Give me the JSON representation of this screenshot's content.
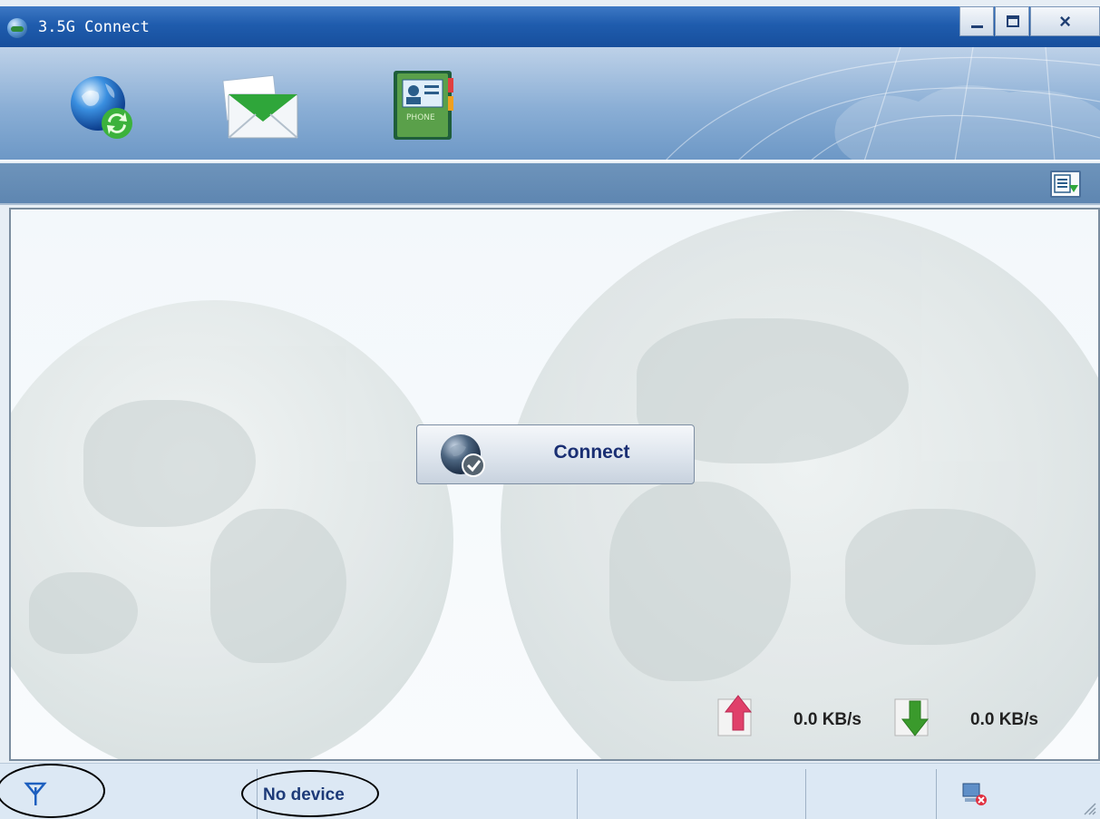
{
  "window": {
    "title": "3.5G Connect",
    "controls": {
      "minimize": "minimize",
      "maximize": "maximize",
      "close": "×"
    }
  },
  "toolbar": {
    "buttons": [
      {
        "id": "internet",
        "icon": "globe-refresh-icon"
      },
      {
        "id": "sms",
        "icon": "envelope-icon"
      },
      {
        "id": "phonebook",
        "icon": "phonebook-icon"
      }
    ],
    "menu_icon": "menu-list-icon"
  },
  "main": {
    "connect_label": "Connect",
    "upload_speed": "0.0 KB/s",
    "download_speed": "0.0 KB/s"
  },
  "statusbar": {
    "signal_icon": "antenna-icon",
    "device_status": "No device",
    "device_icon": "device-disconnected-icon"
  },
  "colors": {
    "titlebar": "#1f5cad",
    "connect_text": "#1a2f73",
    "status_text": "#1d3a78",
    "upload_arrow": "#e0406a",
    "download_arrow": "#3a9a2c"
  }
}
